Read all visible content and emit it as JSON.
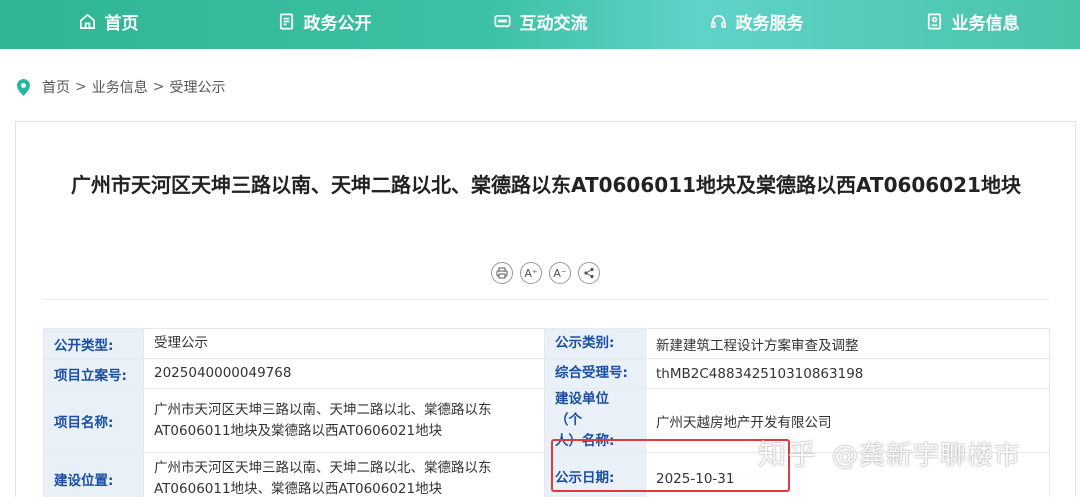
{
  "nav": {
    "items": [
      {
        "label": "首页",
        "icon": "home-icon"
      },
      {
        "label": "政务公开",
        "icon": "document-icon"
      },
      {
        "label": "互动交流",
        "icon": "chat-icon"
      },
      {
        "label": "政务服务",
        "icon": "headset-icon"
      },
      {
        "label": "业务信息",
        "icon": "info-file-icon"
      }
    ]
  },
  "breadcrumb": {
    "items": [
      "首页",
      "业务信息",
      "受理公示"
    ],
    "separator": ">"
  },
  "article": {
    "title": "广州市天河区天坤三路以南、天坤二路以北、棠德路以东AT0606011地块及棠德路以西AT0606021地块",
    "tools": {
      "font_increase": "A⁺",
      "font_decrease": "A⁻"
    }
  },
  "info": {
    "rows": [
      {
        "label1": "公开类型:",
        "value1": [
          "受理公示"
        ],
        "label2": [
          "公示类别:"
        ],
        "value2": "新建建筑工程设计方案审查及调整"
      },
      {
        "label1": "项目立案号:",
        "value1": [
          "2025040000049768"
        ],
        "label2": [
          "综合受理号:"
        ],
        "value2": "thMB2C488342510310863198"
      },
      {
        "label1": "项目名称:",
        "value1": [
          "广州市天河区天坤三路以南、天坤二路以北、棠德路以东",
          "AT0606011地块及棠德路以西AT0606021地块"
        ],
        "label2": [
          "建设单位（个",
          "人）名称:"
        ],
        "value2": "广州天越房地产开发有限公司"
      },
      {
        "label1": "建设位置:",
        "value1": [
          "广州市天河区天坤三路以南、天坤二路以北、棠德路以东",
          "AT0606011地块、棠德路以西AT0606021地块"
        ],
        "label2": [
          "公示日期:"
        ],
        "value2": "2025-10-31"
      }
    ]
  },
  "watermark": {
    "brand": "知乎",
    "user": "@龚新宇聊楼市"
  },
  "colors": {
    "nav_start": "#2fb593",
    "nav_end": "#48c4a8",
    "label_bg": "#eaf0f8",
    "label_text": "#1a4fa3",
    "highlight": "#e0393e",
    "location_pin": "#29b6a0"
  }
}
